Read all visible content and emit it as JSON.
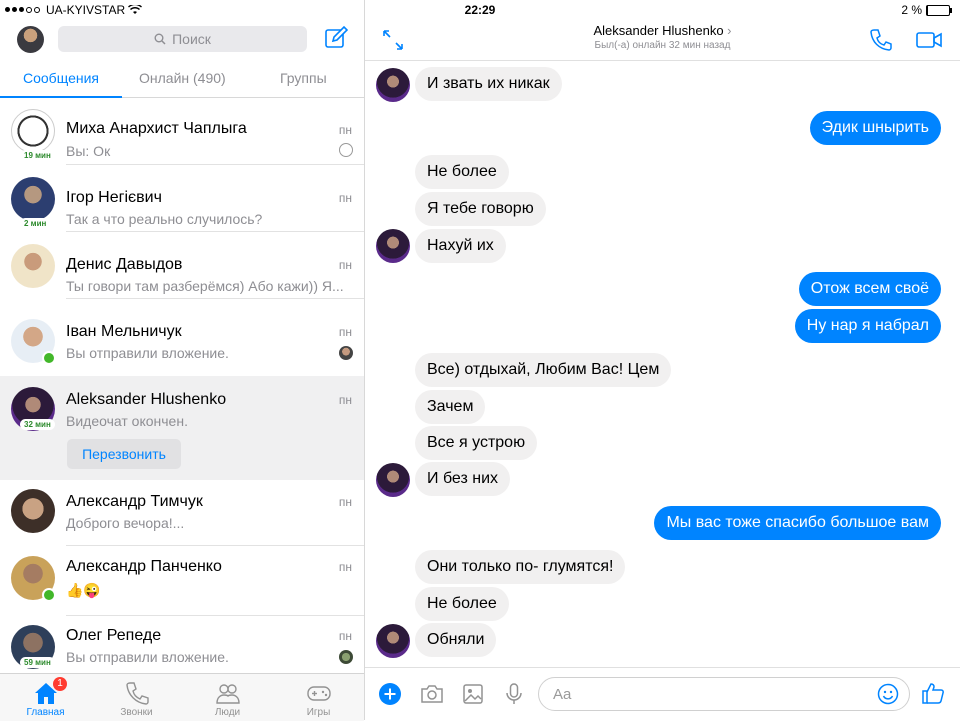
{
  "status_bar": {
    "carrier": "UA-KYIVSTAR",
    "time": "22:29",
    "battery": "2 %",
    "battery_level": 0.02
  },
  "left": {
    "search_placeholder": "Поиск",
    "tabs": [
      "Сообщения",
      "Онлайн (490)",
      "Группы"
    ],
    "conversations": [
      {
        "name": "Миха Анархист Чаплыга",
        "snippet": "Вы: Ок",
        "time": "пн",
        "badge": "19 мин"
      },
      {
        "name": "Ігор Негієвич",
        "snippet": "Так а что реально случилось?",
        "time": "пн",
        "badge": "2 мин"
      },
      {
        "name": "Денис Давыдов",
        "snippet": "Ты говори там разберёмся) Або кажи)) Я...",
        "time": "пн"
      },
      {
        "name": "Іван Мельничук",
        "snippet": "Вы отправили вложение.",
        "time": "пн"
      },
      {
        "name": "Aleksander Hlushenko",
        "snippet": "Видеочат окончен.",
        "time": "пн",
        "badge": "32 мин",
        "action": "Перезвонить"
      },
      {
        "name": "Александр Тимчук",
        "snippet": "Доброго вечора!...",
        "time": "пн"
      },
      {
        "name": "Александр Панченко",
        "snippet": "👍😜",
        "time": "пн"
      },
      {
        "name": "Олег Репеде",
        "snippet": "Вы отправили вложение.",
        "time": "пн",
        "badge": "59 мин"
      }
    ],
    "tabbar": [
      {
        "label": "Главная",
        "badge": "1"
      },
      {
        "label": "Звонки"
      },
      {
        "label": "Люди"
      },
      {
        "label": "Игры"
      }
    ]
  },
  "chat": {
    "title": "Aleksander Hlushenko",
    "subtitle": "Был(-а) онлайн 32 мин назад",
    "messages": [
      {
        "text": "И звать их никак",
        "dir": "in"
      },
      {
        "text": "Эдик шнырить",
        "dir": "out"
      },
      {
        "text": "Не более",
        "dir": "in"
      },
      {
        "text": "Я тебе говорю",
        "dir": "in"
      },
      {
        "text": "Нахуй их",
        "dir": "in"
      },
      {
        "text": "Отож всем своё",
        "dir": "out"
      },
      {
        "text": "Ну нар я набрал",
        "dir": "out"
      },
      {
        "text": "Все) отдыхай, Любим Вас! Цем",
        "dir": "in"
      },
      {
        "text": "Зачем",
        "dir": "in"
      },
      {
        "text": "Все я устрою",
        "dir": "in"
      },
      {
        "text": "И без них",
        "dir": "in"
      },
      {
        "text": "Мы вас тоже спасибо большое вам",
        "dir": "out"
      },
      {
        "text": "Они только по- глумятся!",
        "dir": "in"
      },
      {
        "text": "Не более",
        "dir": "in"
      },
      {
        "text": "Обняли",
        "dir": "in"
      }
    ],
    "composer_placeholder": "Aa"
  },
  "colors": {
    "accent": "#0084ff",
    "incoming_bubble": "#f1f0f0",
    "online": "#42b72a",
    "badge": "#ff3b30"
  }
}
